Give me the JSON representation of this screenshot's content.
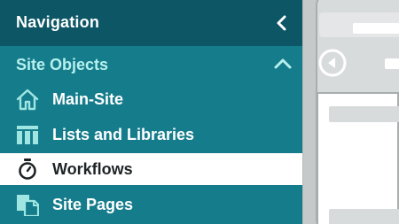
{
  "navigation": {
    "title": "Navigation",
    "collapse_icon": "chevron-left-icon"
  },
  "section": {
    "title": "Site Objects",
    "toggle_icon": "chevron-up-icon",
    "expanded": true
  },
  "items": [
    {
      "label": "Main-Site",
      "icon": "home-icon",
      "active": false
    },
    {
      "label": "Lists and Libraries",
      "icon": "columns-icon",
      "active": false
    },
    {
      "label": "Workflows",
      "icon": "stopwatch-icon",
      "active": true
    },
    {
      "label": "Site Pages",
      "icon": "pages-icon",
      "active": false
    }
  ],
  "colors": {
    "sidebar": "#157c8b",
    "header": "#0c5665",
    "section_title": "#b6f0ee",
    "active_bg": "#ffffff",
    "active_text": "#1e2426",
    "icon": "#9fe6e3"
  }
}
